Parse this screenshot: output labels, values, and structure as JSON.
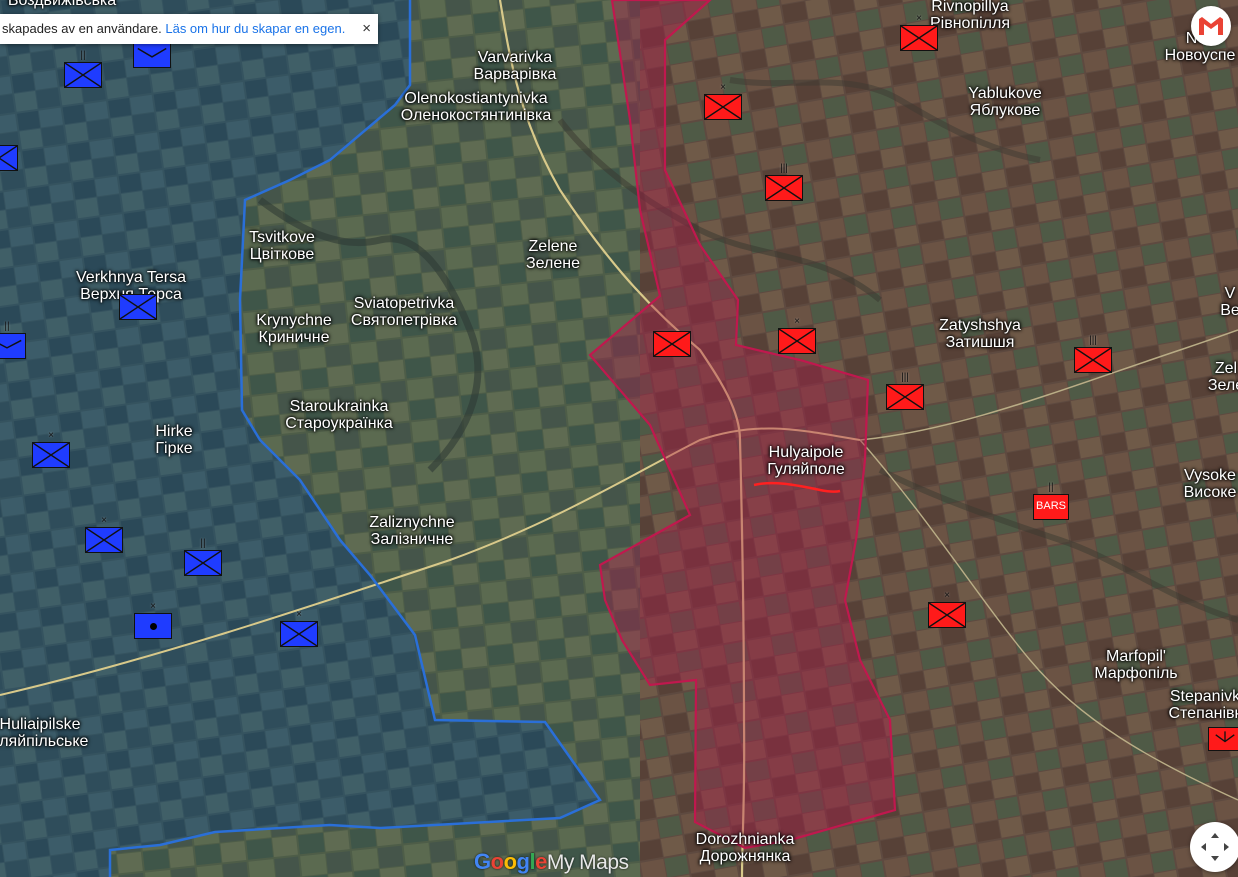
{
  "map": {
    "colors": {
      "russian_zone": "#c0184e",
      "ukrainian_front": "#2a6fd8",
      "russian_unit": "#ff1a1a",
      "ukrainian_unit": "#1f3cff",
      "road": "#d8c98a"
    },
    "places": [
      {
        "id": "vozdvyzhivska",
        "lat": "",
        "cyr": "Воздвижівська"
      },
      {
        "id": "varvarivka",
        "lat": "Varvarivka",
        "cyr": "Варварівка"
      },
      {
        "id": "olenokostiantynivka",
        "lat": "Olenokostiantynivka",
        "cyr": "Оленокостянтинівка"
      },
      {
        "id": "rivnopillya",
        "lat": "Rivnopillya",
        "cyr": "Рівнопілля"
      },
      {
        "id": "novouspenivske",
        "lat": "Nov",
        "cyr": "Новоуспе"
      },
      {
        "id": "yablukove",
        "lat": "Yablukove",
        "cyr": "Яблукове"
      },
      {
        "id": "tsvitkove",
        "lat": "Tsvitkove",
        "cyr": "Цвіткове"
      },
      {
        "id": "zelene",
        "lat": "Zelene",
        "cyr": "Зелене"
      },
      {
        "id": "verkhnya-tersa",
        "lat": "Verkhnya Tersa",
        "cyr": "Верхня Терса"
      },
      {
        "id": "sviatopetrivka",
        "lat": "Sviatopetrivka",
        "cyr": "Святопетрівка"
      },
      {
        "id": "krynychne",
        "lat": "Krynychne",
        "cyr": "Криничне"
      },
      {
        "id": "zatyshshya",
        "lat": "Zatyshshya",
        "cyr": "Затишшя"
      },
      {
        "id": "v-east",
        "lat": "V",
        "cyr": "Ве"
      },
      {
        "id": "zelene-east",
        "lat": "Zel",
        "cyr": "Зеле"
      },
      {
        "id": "staroukrainka",
        "lat": "Staroukrainka",
        "cyr": "Староукраїнка"
      },
      {
        "id": "hirke",
        "lat": "Hirke",
        "cyr": "Гірке"
      },
      {
        "id": "hulyaipole",
        "lat": "Hulyaipole",
        "cyr": "Гуляйполе"
      },
      {
        "id": "vysokohirne",
        "lat": "Vysoke",
        "cyr": "Високе"
      },
      {
        "id": "zaliznychne",
        "lat": "Zaliznychne",
        "cyr": "Залізничне"
      },
      {
        "id": "marfopil",
        "lat": "Marfopil'",
        "cyr": "Марфопіль"
      },
      {
        "id": "huliaipilske",
        "lat": "Huliaipilske",
        "cyr": "уляйпільське"
      },
      {
        "id": "stepanivka",
        "lat": "Stepanivk",
        "cyr": "Степанівк"
      },
      {
        "id": "dorozhnianka",
        "lat": "Dorozhnianka",
        "cyr": "Дорожнянка"
      }
    ],
    "units": [
      {
        "side": "ua",
        "type": "x",
        "echelon": "",
        "label": ""
      },
      {
        "side": "ua",
        "type": "x",
        "echelon": "||",
        "label": ""
      },
      {
        "side": "ua",
        "type": "x",
        "echelon": "",
        "label": ""
      },
      {
        "side": "ua",
        "type": "x",
        "echelon": "",
        "label": ""
      },
      {
        "side": "ua",
        "type": "x",
        "echelon": "||",
        "label": ""
      },
      {
        "side": "ua",
        "type": "x",
        "echelon": "",
        "label": ""
      },
      {
        "side": "ua",
        "type": "x",
        "echelon": "×",
        "label": ""
      },
      {
        "side": "ua",
        "type": "x",
        "echelon": "×",
        "label": ""
      },
      {
        "side": "ua",
        "type": "x",
        "echelon": "||",
        "label": ""
      },
      {
        "side": "ua",
        "type": "dot",
        "echelon": "×",
        "label": ""
      },
      {
        "side": "ua",
        "type": "x",
        "echelon": "×",
        "label": ""
      },
      {
        "side": "ru",
        "type": "x",
        "echelon": "×",
        "label": ""
      },
      {
        "side": "ru",
        "type": "x",
        "echelon": "×",
        "label": ""
      },
      {
        "side": "ru",
        "type": "x",
        "echelon": "|||",
        "label": ""
      },
      {
        "side": "ru",
        "type": "x",
        "echelon": "",
        "label": ""
      },
      {
        "side": "ru",
        "type": "x",
        "echelon": "×",
        "label": ""
      },
      {
        "side": "ru",
        "type": "x",
        "echelon": "|||",
        "label": ""
      },
      {
        "side": "ru",
        "type": "x",
        "echelon": "|||",
        "label": ""
      },
      {
        "side": "ru",
        "type": "text",
        "echelon": "||",
        "label": "BARS"
      },
      {
        "side": "ru",
        "type": "x",
        "echelon": "×",
        "label": ""
      },
      {
        "side": "ru",
        "type": "x",
        "echelon": "",
        "label": ""
      }
    ]
  },
  "notice": {
    "text": "skapades av en användare.",
    "link": "Läs om hur du skapar en egen.",
    "close": "×"
  },
  "branding": {
    "google": "Google",
    "my_maps": "My Maps"
  },
  "controls": {
    "fullscreen_icon": "expand-arrows-icon",
    "gmail_icon": "gmail-icon"
  }
}
